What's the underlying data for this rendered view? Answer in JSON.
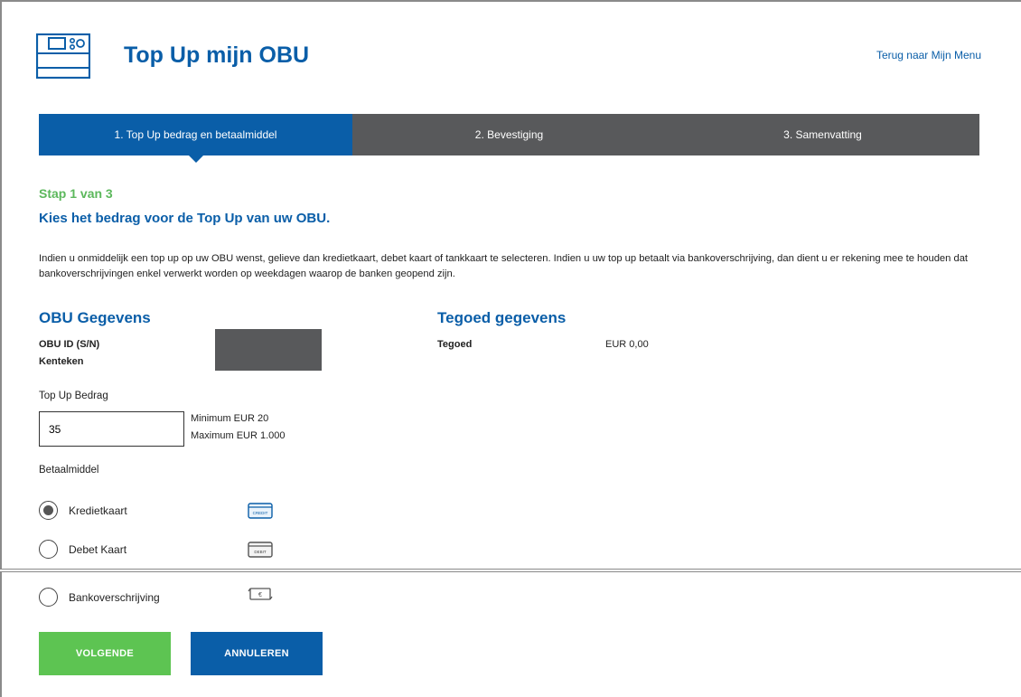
{
  "header": {
    "title": "Top Up mijn OBU",
    "back_link": "Terug naar Mijn Menu"
  },
  "stepper": {
    "steps": [
      {
        "label": "1. Top Up bedrag en betaalmiddel",
        "active": true
      },
      {
        "label": "2. Bevestiging",
        "active": false
      },
      {
        "label": "3. Samenvatting",
        "active": false
      }
    ]
  },
  "step_indicator": "Stap 1 van 3",
  "step_heading": "Kies het bedrag voor de Top Up van uw OBU.",
  "info_text": "Indien u onmiddelijk een top up op uw OBU wenst, gelieve dan kredietkaart, debet kaart of tankkaart te selecteren. Indien u uw top up betaalt via bankoverschrijving, dan dient u er rekening mee te houden dat bankoverschrijvingen enkel verwerkt worden op weekdagen waarop de banken geopend zijn.",
  "obu": {
    "title": "OBU Gegevens",
    "id_label": "OBU ID (S/N)",
    "plate_label": "Kenteken"
  },
  "tegoed": {
    "title": "Tegoed gegevens",
    "label": "Tegoed",
    "value": "EUR 0,00"
  },
  "amount": {
    "label": "Top Up Bedrag",
    "value": "35",
    "minimum": "Minimum EUR 20",
    "maximum": "Maximum EUR 1.000"
  },
  "payment": {
    "label": "Betaalmiddel",
    "options": [
      {
        "label": "Kredietkaart",
        "selected": true,
        "icon": "credit-card-icon",
        "icon_text": "CREDIT"
      },
      {
        "label": "Debet Kaart",
        "selected": false,
        "icon": "debit-card-icon",
        "icon_text": "DEBIT"
      },
      {
        "label": "Bankoverschrijving",
        "selected": false,
        "icon": "bank-transfer-icon",
        "icon_text": "€"
      }
    ]
  },
  "buttons": {
    "next": "VOLGENDE",
    "cancel": "ANNULEREN"
  },
  "colors": {
    "primary_blue": "#0a5ea8",
    "step_inactive": "#58595b",
    "success_green": "#5dc452"
  }
}
